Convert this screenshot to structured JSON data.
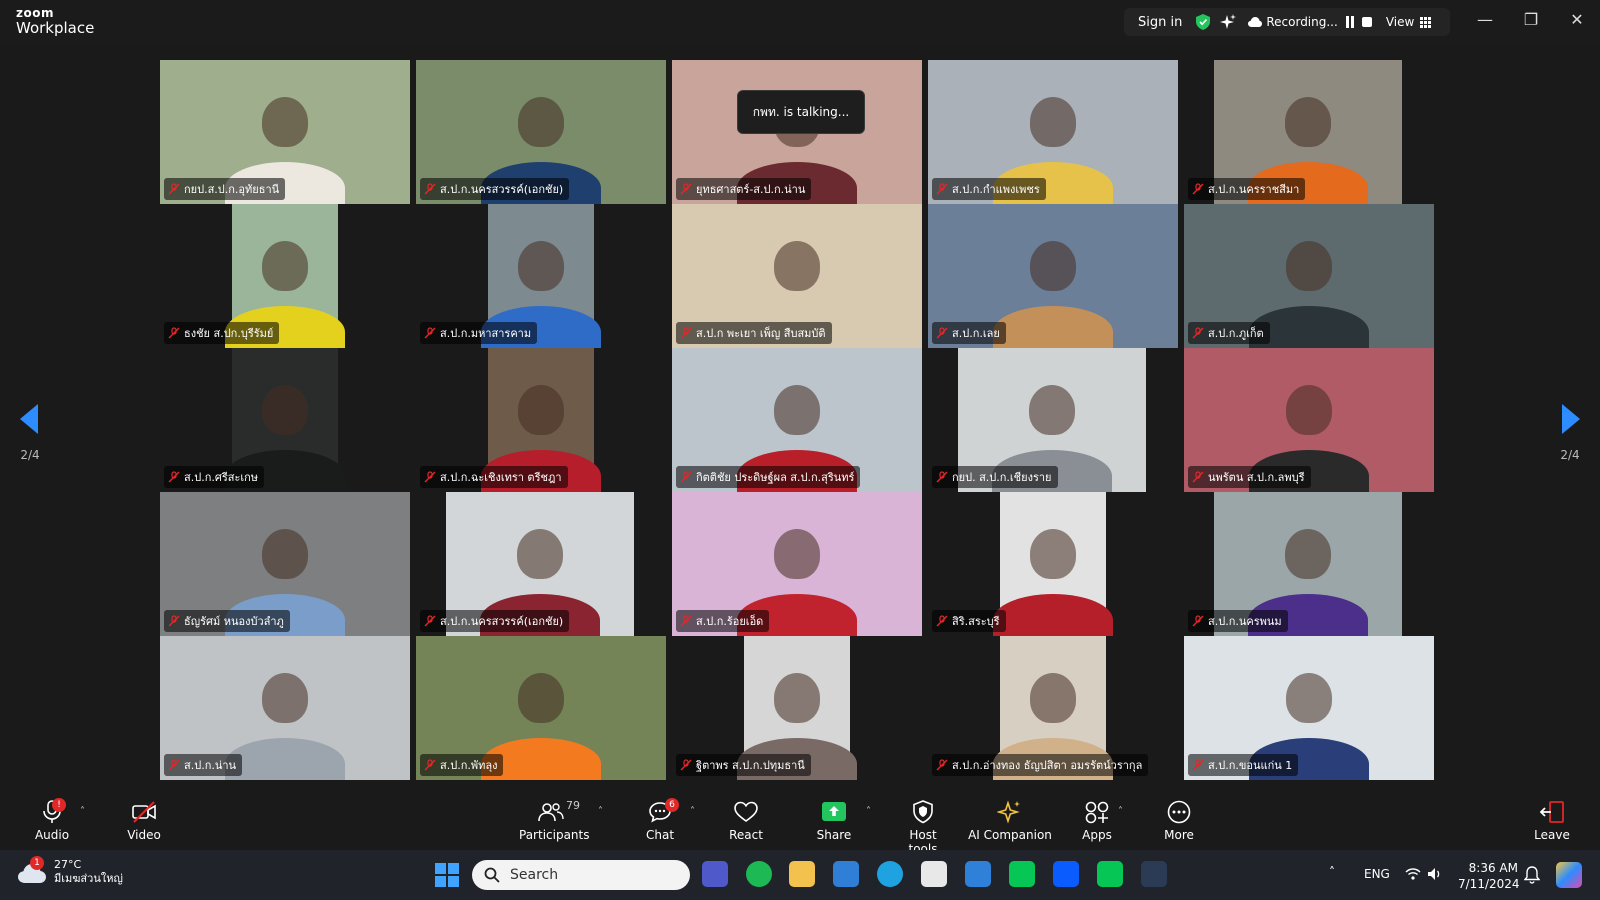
{
  "app": {
    "brand_top": "zoom",
    "brand_bottom": "Workplace"
  },
  "topbar": {
    "sign_in": "Sign in",
    "recording": "Recording...",
    "view": "View"
  },
  "talking": "กพท. is talking...",
  "pagination": {
    "left": "2/4",
    "right": "2/4"
  },
  "participants_grid": [
    {
      "name": "กยป.ส.ป.ก.อุทัยธานี"
    },
    {
      "name": "ส.ป.ก.นครสวรรค์(เอกชัย)"
    },
    {
      "name": "ยุทธศาสตร์-ส.ป.ก.น่าน"
    },
    {
      "name": "ส.ป.ก.กำแพงเพชร"
    },
    {
      "name": "ส.ป.ก.นครราชสีมา"
    },
    {
      "name": "ธงชัย ส.ปก.บุรีรัมย์"
    },
    {
      "name": "ส.ป.ก.มหาสารคาม"
    },
    {
      "name": "ส.ป.ก พะเยา เพ็ญ สืบสมบัติ"
    },
    {
      "name": "ส.ป.ก.เลย"
    },
    {
      "name": "ส.ป.ก.ภูเก็ต"
    },
    {
      "name": "ส.ป.ก.ศรีสะเกษ"
    },
    {
      "name": "ส.ป.ก.ฉะเชิงเทรา ตรีชฎา"
    },
    {
      "name": "กิตติชัย ประดิษฐ์ผล ส.ป.ก.สุรินทร์"
    },
    {
      "name": "กยป. ส.ป.ก.เชียงราย"
    },
    {
      "name": "นพรัตน ส.ป.ก.ลพบุรี"
    },
    {
      "name": "ธัญรัศม์ หนองบัวลำภู"
    },
    {
      "name": "ส.ป.ก.นครสวรรค์(เอกชัย)"
    },
    {
      "name": "ส.ป.ก.ร้อยเอ็ด"
    },
    {
      "name": "สิริ.สระบุรี"
    },
    {
      "name": "ส.ป.ก.นครพนม"
    },
    {
      "name": "ส.ป.ก.น่าน"
    },
    {
      "name": "ส.ป.ก.พัทลุง"
    },
    {
      "name": "ฐิตาพร ส.ป.ก.ปทุมธานี"
    },
    {
      "name": "ส.ป.ก.อ่างทอง ธัญปสิตา อมรรัตน์วรากุล"
    },
    {
      "name": "ส.ป.ก.ขอนแก่น 1"
    }
  ],
  "toolbar": {
    "audio": "Audio",
    "video": "Video",
    "participants": "Participants",
    "participants_count": "79",
    "chat": "Chat",
    "chat_badge": "6",
    "react": "React",
    "share": "Share",
    "host_tools": "Host tools",
    "ai_companion": "AI Companion",
    "apps": "Apps",
    "more": "More",
    "leave": "Leave",
    "audio_badge": "!"
  },
  "taskbar": {
    "weather_temp": "27°C",
    "weather_desc": "มีเมฆส่วนใหญ่",
    "weather_badge": "1",
    "search_placeholder": "Search",
    "lang": "ENG",
    "time": "8:36 AM",
    "date": "7/11/2024"
  },
  "colors": {
    "accent": "#0b5cff",
    "share_green": "#22c55e",
    "danger": "#e02828"
  }
}
